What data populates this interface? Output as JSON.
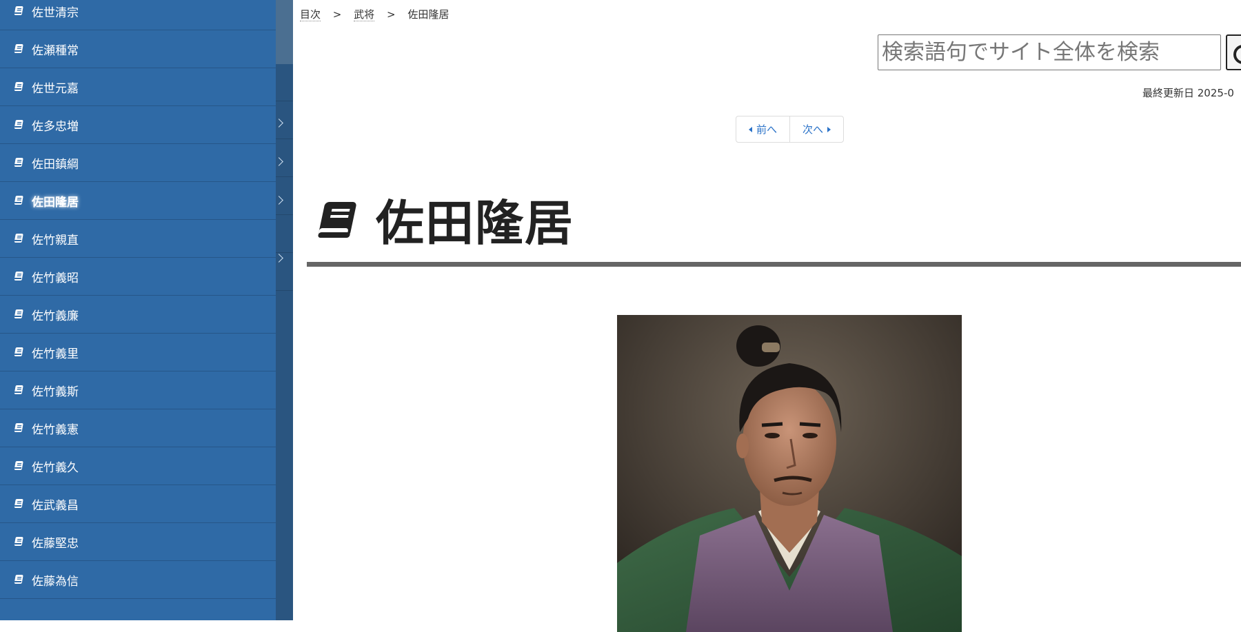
{
  "sidebar": {
    "items": [
      {
        "label": "佐世清宗"
      },
      {
        "label": "佐瀬種常"
      },
      {
        "label": "佐世元嘉"
      },
      {
        "label": "佐多忠増"
      },
      {
        "label": "佐田鎮綱"
      },
      {
        "label": "佐田隆居",
        "active": true
      },
      {
        "label": "佐竹親直"
      },
      {
        "label": "佐竹義昭"
      },
      {
        "label": "佐竹義廉"
      },
      {
        "label": "佐竹義里"
      },
      {
        "label": "佐竹義斯"
      },
      {
        "label": "佐竹義憲"
      },
      {
        "label": "佐竹義久"
      },
      {
        "label": "佐武義昌"
      },
      {
        "label": "佐藤堅忠"
      },
      {
        "label": "佐藤為信"
      }
    ]
  },
  "breadcrumb": {
    "items": [
      {
        "label": "目次"
      },
      {
        "label": "武将"
      }
    ],
    "separator": ">",
    "current": "佐田隆居"
  },
  "search": {
    "placeholder": "検索語句でサイト全体を検索"
  },
  "meta": {
    "last_updated": "最終更新日 2025-0"
  },
  "pager": {
    "prev_label": "前へ",
    "next_label": "次へ"
  },
  "page": {
    "title": "佐田隆居",
    "title_icon": "book-icon"
  },
  "colors": {
    "sidebar_bg": "#2f6aa6",
    "rail_bg": "#2a5580",
    "link": "#2a72c8",
    "title_rule": "#666666"
  },
  "icons": {
    "sidebar_item_icon": "book-icon",
    "search_button_icon": "search-icon",
    "prev_icon": "caret-left-icon",
    "next_icon": "caret-right-icon",
    "rail_icon": "chevron-right-icon"
  }
}
